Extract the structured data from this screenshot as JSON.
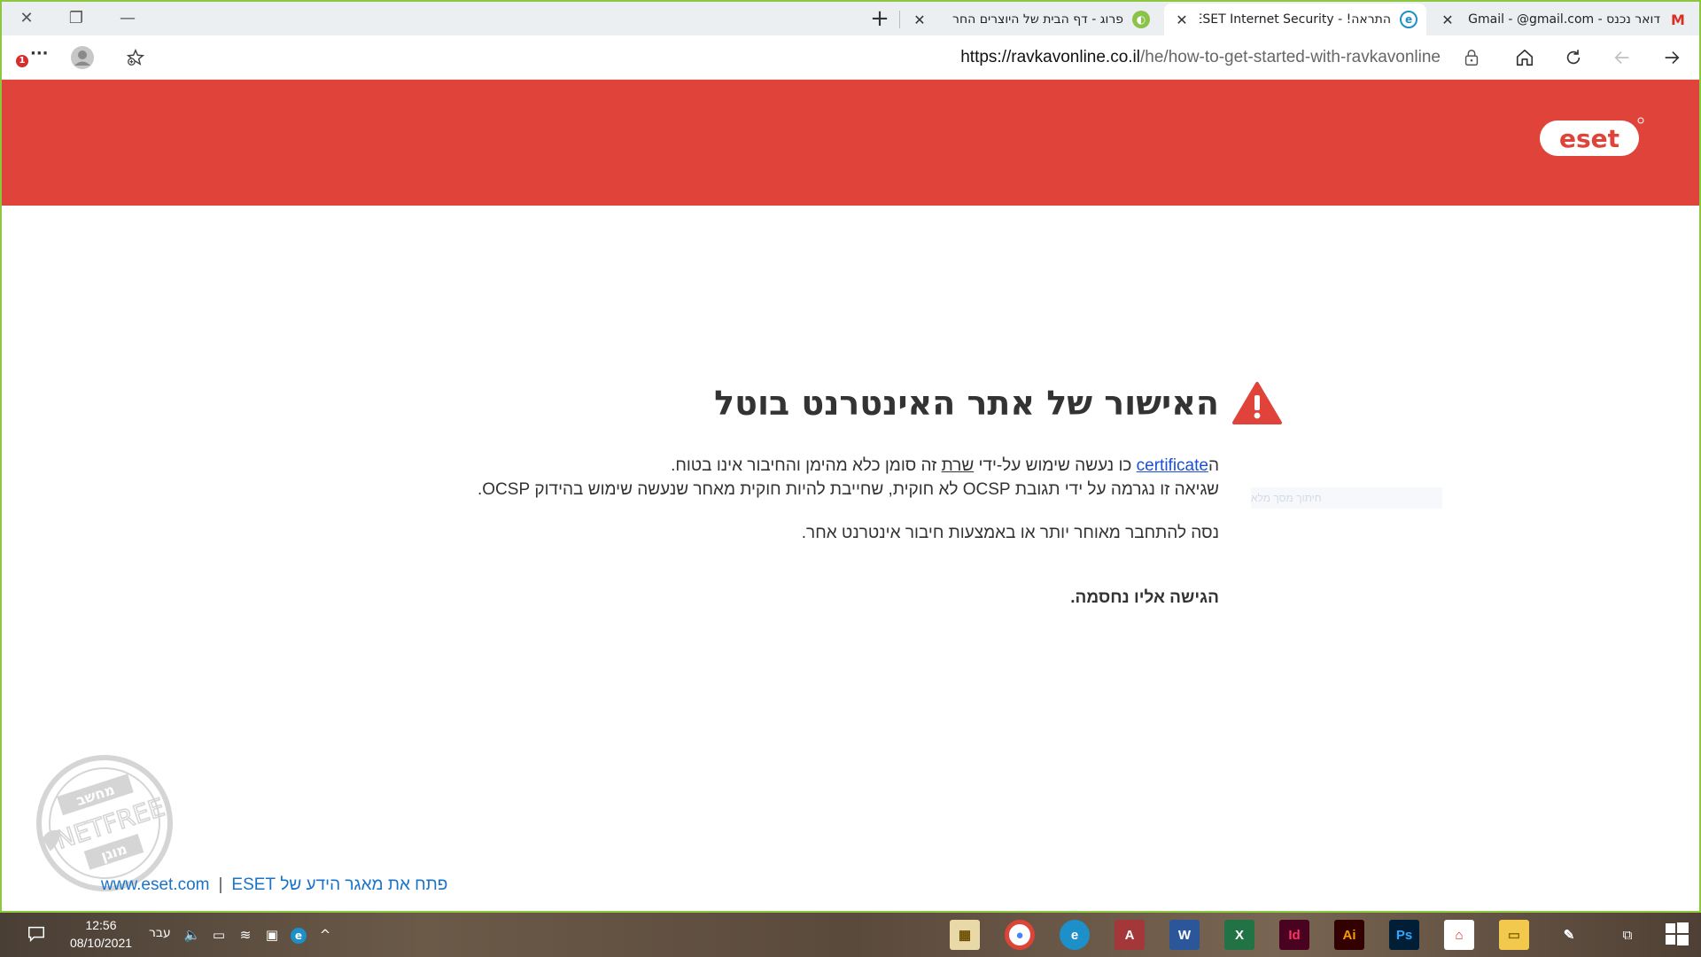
{
  "browser": {
    "tabs": [
      {
        "title": "דואר נכנס - Gmail - @gmail.com",
        "favicon": "gmail-icon",
        "active": false
      },
      {
        "title": "התראה! - ESET Internet Security",
        "favicon": "edge-page-icon",
        "active": true
      },
      {
        "title": "פרוג - דף הבית של היוצרים החר",
        "favicon": "prog-icon",
        "active": false
      }
    ],
    "new_tab_symbol": "+",
    "address": {
      "host": "https://ravkavonline.co.il",
      "path": "/he/how-to-get-started-with-ravkavonline"
    },
    "notification_count": "1",
    "menu_symbol": "···"
  },
  "page": {
    "brand": "eset",
    "title": "האישור של אתר האינטרנט בוטל",
    "line1_prefix": "ה",
    "line1_link": "certificate",
    "line1_mid": " כו נעשה שימוש על-ידי ",
    "line1_underlined": "שרת",
    "line1_suffix": " זה סומן כלא מהימן והחיבור אינו בטוח.",
    "line2": "שגיאה זו נגרמה על ידי תגובת OCSP לא חוקית, שחייבת להיות חוקית מאחר שנעשה שימוש בהידוק OCSP.",
    "line3": "נסה להתחבר מאוחר יותר או באמצעות חיבור אינטרנט אחר.",
    "blocked": "הגישה אליו נחסמה.",
    "faint_field": "חיתוך מסך מלא",
    "footer": {
      "site_link": "www.eset.com",
      "separator": "|",
      "kb_link": "פתח את מאגר הידע של ESET"
    },
    "stamp": {
      "top": "מחשב",
      "middle": "NETFREE",
      "bottom": "מוגן"
    }
  },
  "taskbar": {
    "time": "12:56",
    "date": "08/10/2021",
    "language": "עבר",
    "apps": [
      {
        "name": "file-explorer-calendar",
        "label": "▦"
      },
      {
        "name": "chrome",
        "label": "●"
      },
      {
        "name": "edge",
        "label": "e"
      },
      {
        "name": "access",
        "label": "A"
      },
      {
        "name": "word",
        "label": "W"
      },
      {
        "name": "excel",
        "label": "X"
      },
      {
        "name": "indesign",
        "label": "Id"
      },
      {
        "name": "illustrator",
        "label": "Ai"
      },
      {
        "name": "photoshop",
        "label": "Ps"
      },
      {
        "name": "acrobat",
        "label": "⌂"
      },
      {
        "name": "folder",
        "label": "▭"
      },
      {
        "name": "paint",
        "label": "✎"
      }
    ]
  },
  "colors": {
    "eset_red": "#e0433a",
    "link_blue": "#1a4fd8",
    "window_border": "#8dc63f"
  }
}
